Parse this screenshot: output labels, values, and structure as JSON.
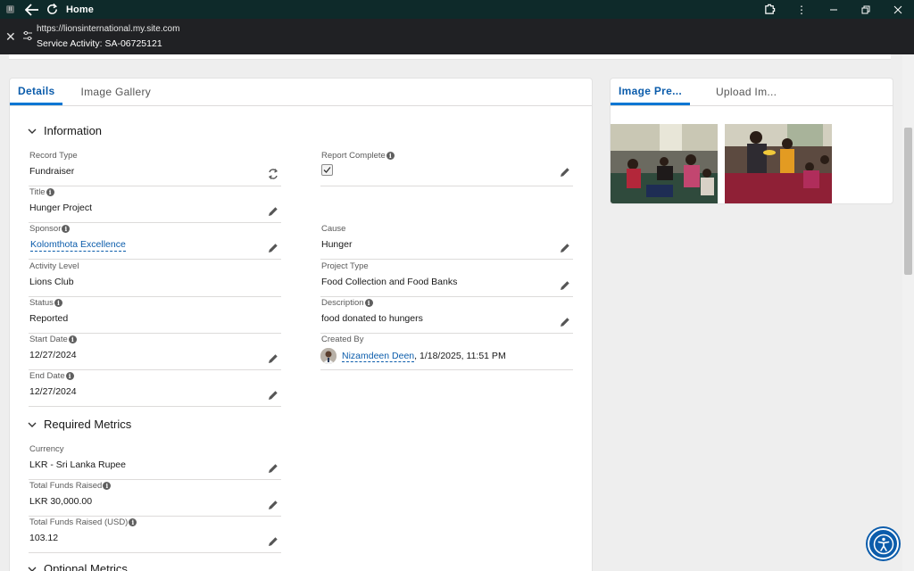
{
  "window": {
    "title": "Home"
  },
  "urlbar": {
    "url": "https://lionsinternational.my.site.com",
    "page_name": "Service Activity: SA-06725121"
  },
  "main": {
    "tabs": [
      {
        "label": "Details",
        "active": true
      },
      {
        "label": "Image Gallery",
        "active": false
      }
    ],
    "sections": {
      "information": "Information",
      "required_metrics": "Required Metrics",
      "optional_metrics": "Optional Metrics"
    },
    "fields": {
      "record_type": {
        "label": "Record Type",
        "value": "Fundraiser"
      },
      "report_complete": {
        "label": "Report Complete",
        "checked": true
      },
      "title": {
        "label": "Title",
        "value": "Hunger Project"
      },
      "sponsor": {
        "label": "Sponsor",
        "value": "Kolomthota Excellence"
      },
      "cause": {
        "label": "Cause",
        "value": "Hunger"
      },
      "activity_level": {
        "label": "Activity Level",
        "value": "Lions Club"
      },
      "project_type": {
        "label": "Project Type",
        "value": "Food Collection and Food Banks"
      },
      "status": {
        "label": "Status",
        "value": "Reported"
      },
      "description": {
        "label": "Description",
        "value": "food donated to hungers"
      },
      "start_date": {
        "label": "Start Date",
        "value": "12/27/2024"
      },
      "created_by": {
        "label": "Created By",
        "user": "Nizamdeen Deen",
        "timestamp": ", 1/18/2025, 11:51 PM"
      },
      "end_date": {
        "label": "End Date",
        "value": "12/27/2024"
      },
      "currency": {
        "label": "Currency",
        "value": "LKR - Sri Lanka Rupee"
      },
      "total_funds_raised": {
        "label": "Total Funds Raised",
        "value": "LKR 30,000.00"
      },
      "total_funds_raised_usd": {
        "label": "Total Funds Raised (USD)",
        "value": "103.12"
      }
    }
  },
  "side": {
    "tabs": [
      {
        "label": "Image Pre...",
        "active": true
      },
      {
        "label": "Upload Im...",
        "active": false
      }
    ]
  },
  "colors": {
    "brand": "#0176d3",
    "link": "#0b5cab",
    "titlebar": "#0e2a2a",
    "urlbar": "#202124"
  }
}
